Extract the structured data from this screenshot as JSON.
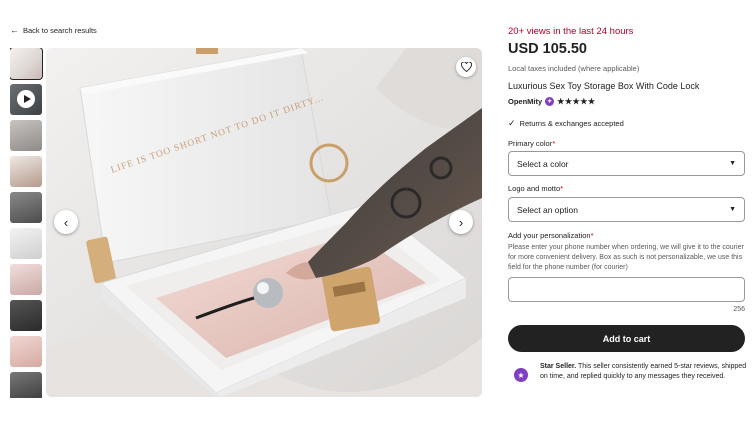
{
  "nav": {
    "back_label": "Back to search results"
  },
  "listing": {
    "views": "20+ views in the last 24 hours",
    "price": "USD 105.50",
    "taxes": "Local taxes included (where applicable)",
    "title": "Luxurious Sex Toy Storage Box With Code Lock",
    "shop_name": "OpenMity",
    "rating_stars": "★★★★★",
    "rating": 5,
    "returns": "Returns & exchanges accepted"
  },
  "image": {
    "lid_text": "LIFE IS TOO SHORT NOT TO DO IT DIRTY..."
  },
  "options": {
    "primary_color_label": "Primary color",
    "primary_color_value": "Select a color",
    "logo_label": "Logo and motto",
    "logo_value": "Select an option",
    "required_mark": "*"
  },
  "personalization": {
    "label": "Add your personalization",
    "help": "Please enter your phone number when ordering, we will give it to the courier for more convenient delivery. Box as such is not personalizable, we use this field for the phone number (for courier)",
    "counter": "256"
  },
  "cart": {
    "button_label": "Add to cart"
  },
  "star_seller": {
    "title": "Star Seller.",
    "text": " This seller consistently earned 5-star reviews, shipped on time, and replied quickly to any messages they received."
  },
  "colors": {
    "accent": "#b3002d",
    "badge": "#7f3fbf",
    "button": "#222222"
  },
  "icons": [
    "back-arrow-icon",
    "heart-icon",
    "chevron-left-icon",
    "chevron-right-icon",
    "play-icon",
    "check-icon",
    "star-seller-icon",
    "caret-down-icon",
    "verified-badge-icon"
  ]
}
